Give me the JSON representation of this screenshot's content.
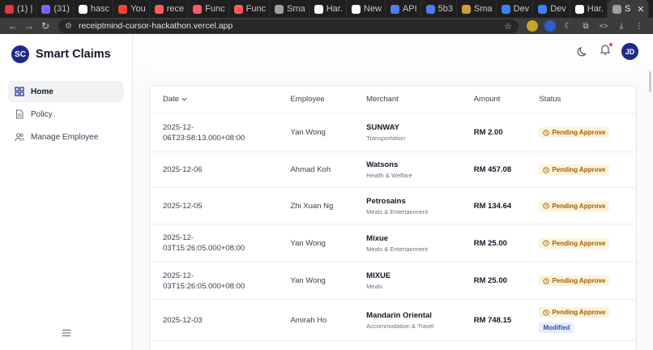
{
  "browser": {
    "tabs": [
      {
        "label": "(1) |",
        "color": "#e53935"
      },
      {
        "label": "(31)",
        "color": "#7b61ff"
      },
      {
        "label": "hasc",
        "color": "#ffffff"
      },
      {
        "label": "You",
        "color": "#f44336"
      },
      {
        "label": "rece",
        "color": "#ff5a5f"
      },
      {
        "label": "Func",
        "color": "#ff5a5f"
      },
      {
        "label": "Func",
        "color": "#ff5a5f"
      },
      {
        "label": "Sma",
        "color": "#9aa0a6"
      },
      {
        "label": "Har.",
        "color": "#ffffff"
      },
      {
        "label": "New",
        "color": "#ffffff"
      },
      {
        "label": "API",
        "color": "#4f7df0"
      },
      {
        "label": "5b3",
        "color": "#4f7df0"
      },
      {
        "label": "Sma",
        "color": "#d59b3a"
      },
      {
        "label": "Dev",
        "color": "#3b82f6"
      },
      {
        "label": "Dev",
        "color": "#3b82f6"
      },
      {
        "label": "Har.",
        "color": "#ffffff"
      },
      {
        "label": "S",
        "color": "#9aa0a6"
      }
    ],
    "close_glyph": "✕",
    "new_tab_glyph": "+",
    "url": "receiptmind-cursor-hackathon.vercel.app"
  },
  "app": {
    "logo": "SC",
    "name": "Smart Claims",
    "nav": [
      {
        "label": "Home",
        "icon": "grid-icon"
      },
      {
        "label": "Policy",
        "icon": "document-icon"
      },
      {
        "label": "Manage Employee",
        "icon": "users-icon"
      }
    ],
    "user_initials": "JD"
  },
  "table": {
    "headers": {
      "date": "Date",
      "employee": "Employee",
      "merchant": "Merchant",
      "amount": "Amount",
      "status": "Status"
    },
    "rows": [
      {
        "date_l1": "2025-12-",
        "date_l2": "06T23:58:13.000+08:00",
        "employee": "Yan Wong",
        "merchant": "SUNWAY",
        "category": "Transportation",
        "amount": "RM 2.00",
        "status": "Pending Approve",
        "extra": ""
      },
      {
        "date_l1": "2025-12-06",
        "date_l2": "",
        "employee": "Ahmad Koh",
        "merchant": "Watsons",
        "category": "Health & Welfare",
        "amount": "RM 457.08",
        "status": "Pending Approve",
        "extra": ""
      },
      {
        "date_l1": "2025-12-05",
        "date_l2": "",
        "employee": "Zhi Xuan Ng",
        "merchant": "Petrosains",
        "category": "Meals & Entertainment",
        "amount": "RM 134.64",
        "status": "Pending Approve",
        "extra": ""
      },
      {
        "date_l1": "2025-12-",
        "date_l2": "03T15:26:05.000+08:00",
        "employee": "Yan Wong",
        "merchant": "Mixue",
        "category": "Meals & Entertainment",
        "amount": "RM 25.00",
        "status": "Pending Approve",
        "extra": ""
      },
      {
        "date_l1": "2025-12-",
        "date_l2": "03T15:26:05.000+08:00",
        "employee": "Yan Wong",
        "merchant": "MIXUE",
        "category": "Meals",
        "amount": "RM 25.00",
        "status": "Pending Approve",
        "extra": ""
      },
      {
        "date_l1": "2025-12-03",
        "date_l2": "",
        "employee": "Amirah Ho",
        "merchant": "Mandarin Oriental",
        "category": "Accommodation & Travel",
        "amount": "RM 748.15",
        "status": "Pending Approve",
        "extra": "Modified"
      }
    ]
  }
}
